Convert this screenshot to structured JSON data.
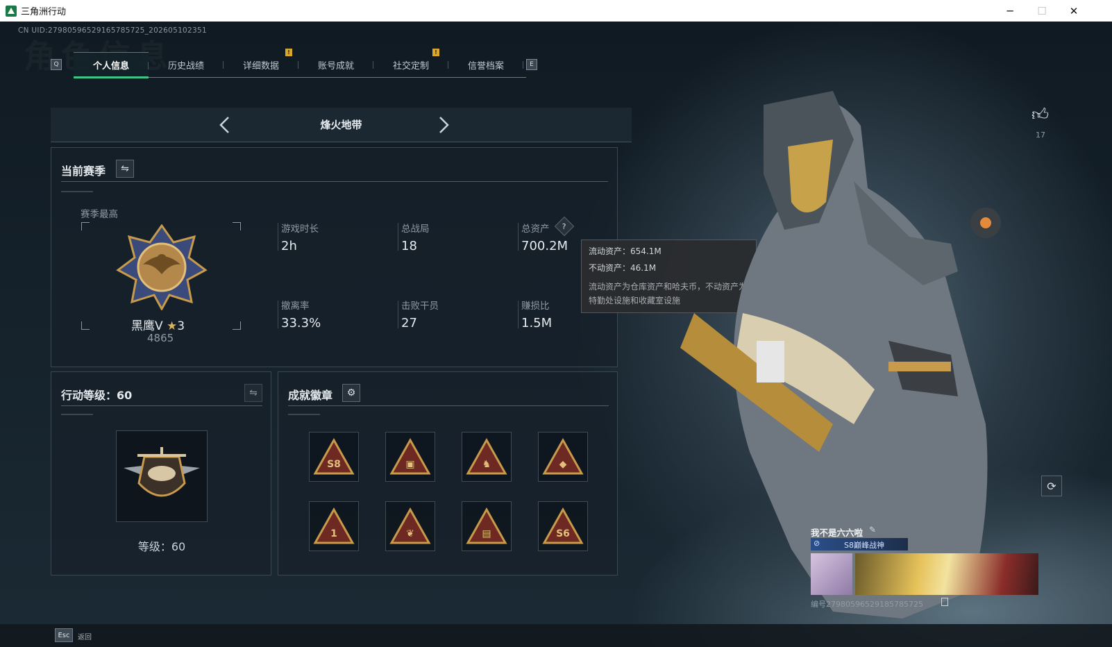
{
  "window": {
    "title": "三角洲行动",
    "minimize_label": "─",
    "maximize_label": "☐",
    "close_label": "✕"
  },
  "header": {
    "uid": "CN UID:279805965291657857​25_202605102351",
    "watermark": "角色信息"
  },
  "tabs": {
    "prev_key": "Q",
    "next_key": "E",
    "items": [
      {
        "label": "个人信息",
        "active": true
      },
      {
        "label": "历史战绩",
        "active": false
      },
      {
        "label": "详细数据",
        "active": false
      },
      {
        "label": "账号成就",
        "active": false
      },
      {
        "label": "社交定制",
        "active": false
      },
      {
        "label": "信誉档案",
        "active": false
      }
    ],
    "notice_marks": [
      "!",
      "!"
    ]
  },
  "mode": {
    "label": "烽火地带"
  },
  "season": {
    "title": "当前赛季",
    "best_label": "赛季最高",
    "rank_name": "黑鹰Ⅴ",
    "rank_stars": "3",
    "rank_score": "4865",
    "stats": [
      {
        "label": "游戏时长",
        "value": "2h"
      },
      {
        "label": "总战局",
        "value": "18"
      },
      {
        "label": "总资产",
        "value": "700.2M"
      },
      {
        "label": "撤离率",
        "value": "33.3%"
      },
      {
        "label": "击败干员",
        "value": "27"
      },
      {
        "label": "赚损比",
        "value": "1.5M"
      }
    ],
    "help_label": "?"
  },
  "tooltip": {
    "liquid": "流动资产：654.1M",
    "fixed": "不动资产：46.1M",
    "note_line1": "流动资产为仓库资产和哈夫币，不动资产为",
    "note_line2": "特勤处设施和收藏室设施"
  },
  "level": {
    "title": "行动等级：60",
    "caption": "等级：60"
  },
  "achievements": {
    "title": "成就徽章",
    "badges": [
      {
        "glyph": "S8"
      },
      {
        "glyph": "▣"
      },
      {
        "glyph": "♞"
      },
      {
        "glyph": "◆"
      },
      {
        "glyph": "1"
      },
      {
        "glyph": "❦"
      },
      {
        "glyph": "▤"
      },
      {
        "glyph": "S6"
      }
    ]
  },
  "likes": {
    "count": "17"
  },
  "profile": {
    "name": "我不是六六啦",
    "title_tag": "S8巅峰战神",
    "uid_line": "编号2798059652918578572​5"
  },
  "footer": {
    "esc_key": "Esc",
    "back_label": "返回"
  },
  "colors": {
    "accent": "#3ec487",
    "gold": "#c89a4b",
    "notice": "#d9a72b"
  }
}
